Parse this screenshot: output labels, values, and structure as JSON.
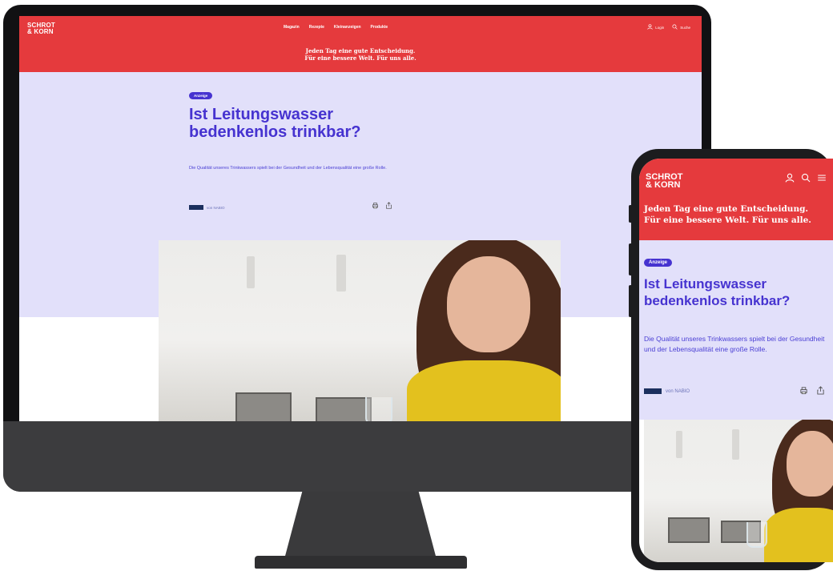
{
  "brand": {
    "logo_line1": "SCHROT",
    "logo_line2": "& KORN",
    "claim_line1": "Jeden Tag eine gute Entscheidung.",
    "claim_line2": "Für eine bessere Welt. Für uns alle."
  },
  "desktop": {
    "nav": [
      "Magazin",
      "Rezepte",
      "Kleinanzeigen",
      "Produkte"
    ],
    "login_label": "Login",
    "search_label": "Suche"
  },
  "article": {
    "badge": "Anzeige",
    "title": "Ist Leitungswasser bedenkenlos trinkbar?",
    "lead": "Die Qualität unseres Trinkwassers spielt bei der Gesundheit und der Lebensqualität eine große Rolle.",
    "sponsor_prefix": "von",
    "sponsor_name": "NABIO"
  },
  "icons": {
    "user": "user-icon",
    "search": "search-icon",
    "menu": "menu-icon",
    "print": "print-icon",
    "share": "share-icon"
  },
  "colors": {
    "brand_red": "#e53a3d",
    "accent_purple": "#4633d0",
    "hero_lavender": "#e2e0fa"
  }
}
